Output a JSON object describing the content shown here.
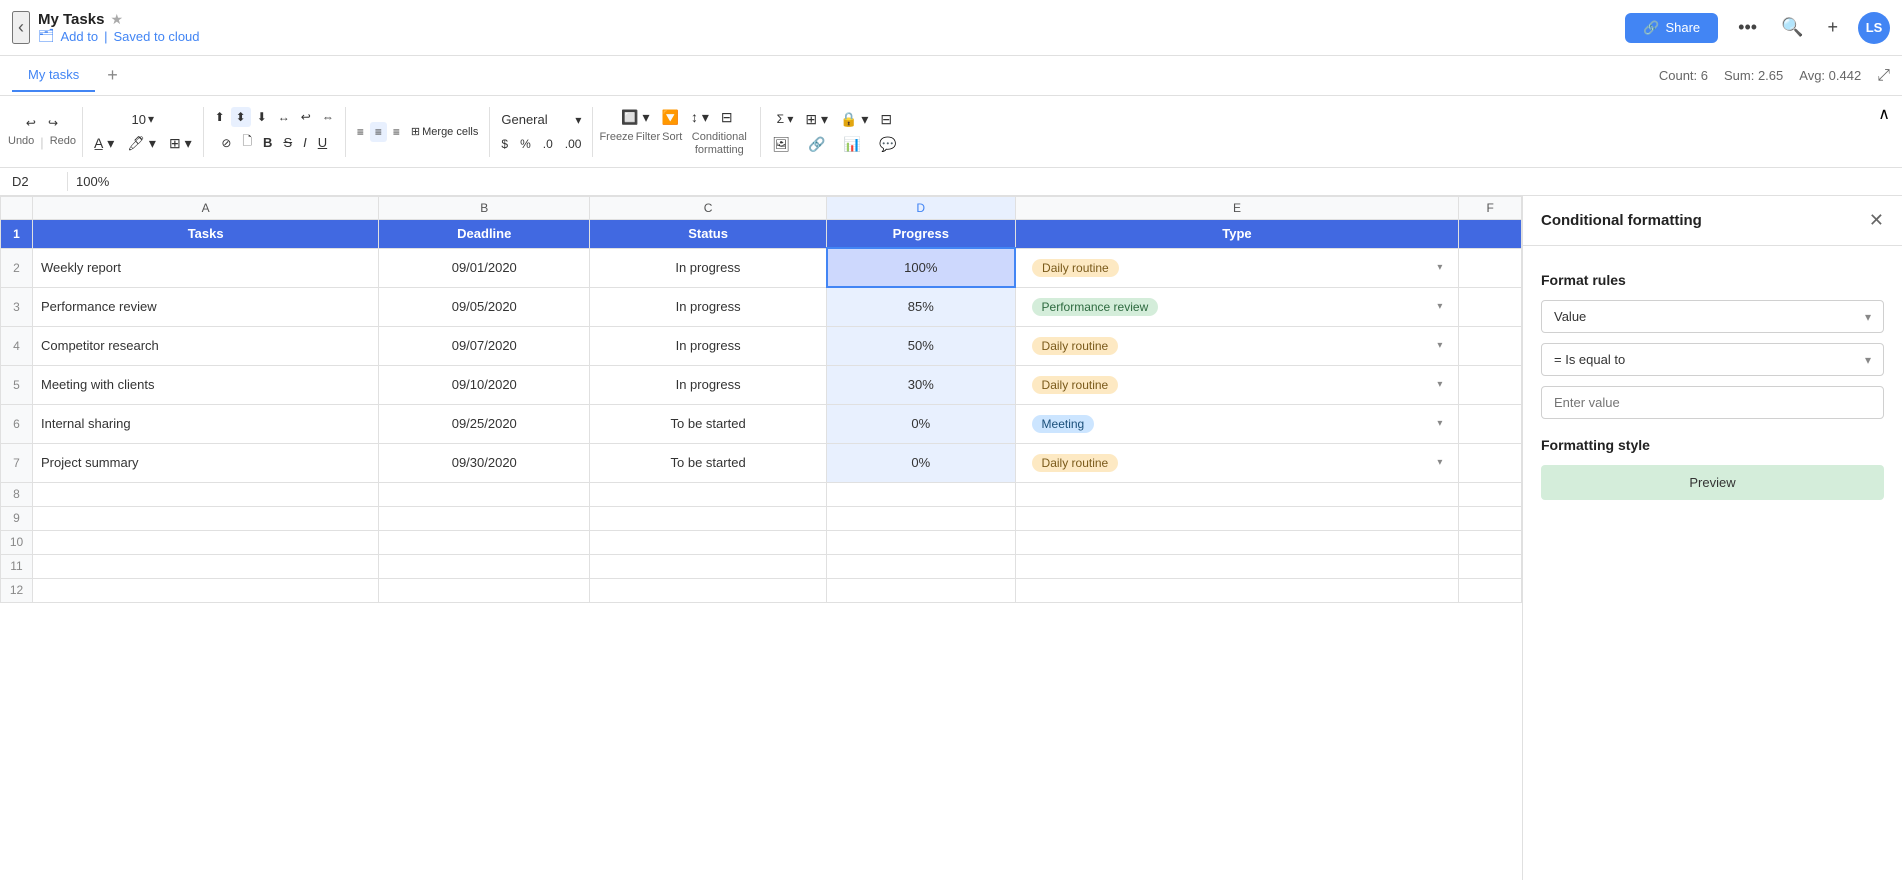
{
  "header": {
    "back_icon": "‹",
    "title": "My Tasks",
    "star_icon": "★",
    "add_to_label": "Add to",
    "saved_label": "Saved to cloud",
    "share_icon": "🔗",
    "share_label": "Share",
    "more_icon": "•••",
    "search_icon": "🔍",
    "add_icon": "+",
    "avatar_initials": "LS"
  },
  "tabs": {
    "items": [
      "My tasks"
    ],
    "active_index": 0,
    "add_icon": "+"
  },
  "tab_bar_right": {
    "count_label": "Count: 6",
    "sum_label": "Sum: 2.65",
    "avg_label": "Avg: 0.442"
  },
  "toolbar": {
    "font_size": "10",
    "format_type": "General",
    "undo_label": "Undo",
    "redo_label": "Redo",
    "bold_label": "B",
    "italic_label": "I",
    "underline_label": "U",
    "strike_label": "S",
    "merge_label": "Merge cells",
    "dollar_label": "$",
    "percent_label": "%",
    "freeze_label": "Freeze",
    "filter_label": "Filter",
    "sort_label": "Sort",
    "cond_format_label": "Conditional formatting",
    "comments_label": "Comments",
    "align_left": "≡",
    "align_center": "≡",
    "align_right": "≡"
  },
  "formula_bar": {
    "cell_ref": "D2",
    "cell_value": "100%"
  },
  "spreadsheet": {
    "col_headers": [
      "",
      "A",
      "B",
      "C",
      "D",
      "E",
      "F"
    ],
    "col_d_selected": true,
    "row_headers": [
      "",
      "1",
      "2",
      "3",
      "4",
      "5",
      "6",
      "7",
      "8",
      "9",
      "10",
      "11",
      "12"
    ],
    "header_row": {
      "tasks": "Tasks",
      "deadline": "Deadline",
      "status": "Status",
      "progress": "Progress",
      "type": "Type"
    },
    "rows": [
      {
        "id": 2,
        "task": "Weekly report",
        "deadline": "09/01/2020",
        "status": "In progress",
        "progress": "100%",
        "type": "Daily routine",
        "type_style": "daily"
      },
      {
        "id": 3,
        "task": "Performance review",
        "deadline": "09/05/2020",
        "status": "In progress",
        "progress": "85%",
        "type": "Performance review",
        "type_style": "perf"
      },
      {
        "id": 4,
        "task": "Competitor research",
        "deadline": "09/07/2020",
        "status": "In progress",
        "progress": "50%",
        "type": "Daily routine",
        "type_style": "daily"
      },
      {
        "id": 5,
        "task": "Meeting with clients",
        "deadline": "09/10/2020",
        "status": "In progress",
        "progress": "30%",
        "type": "Daily routine",
        "type_style": "daily"
      },
      {
        "id": 6,
        "task": "Internal sharing",
        "deadline": "09/25/2020",
        "status": "To be started",
        "progress": "0%",
        "type": "Meeting",
        "type_style": "meeting"
      },
      {
        "id": 7,
        "task": "Project summary",
        "deadline": "09/30/2020",
        "status": "To be started",
        "progress": "0%",
        "type": "Daily routine",
        "type_style": "daily"
      }
    ]
  },
  "right_panel": {
    "title": "Conditional formatting",
    "close_icon": "✕",
    "format_rules_title": "Format rules",
    "value_dropdown": "Value",
    "condition_dropdown": "= Is equal to",
    "value_placeholder": "Enter value",
    "format_style_title": "Formatting style",
    "preview_label": "Preview"
  }
}
